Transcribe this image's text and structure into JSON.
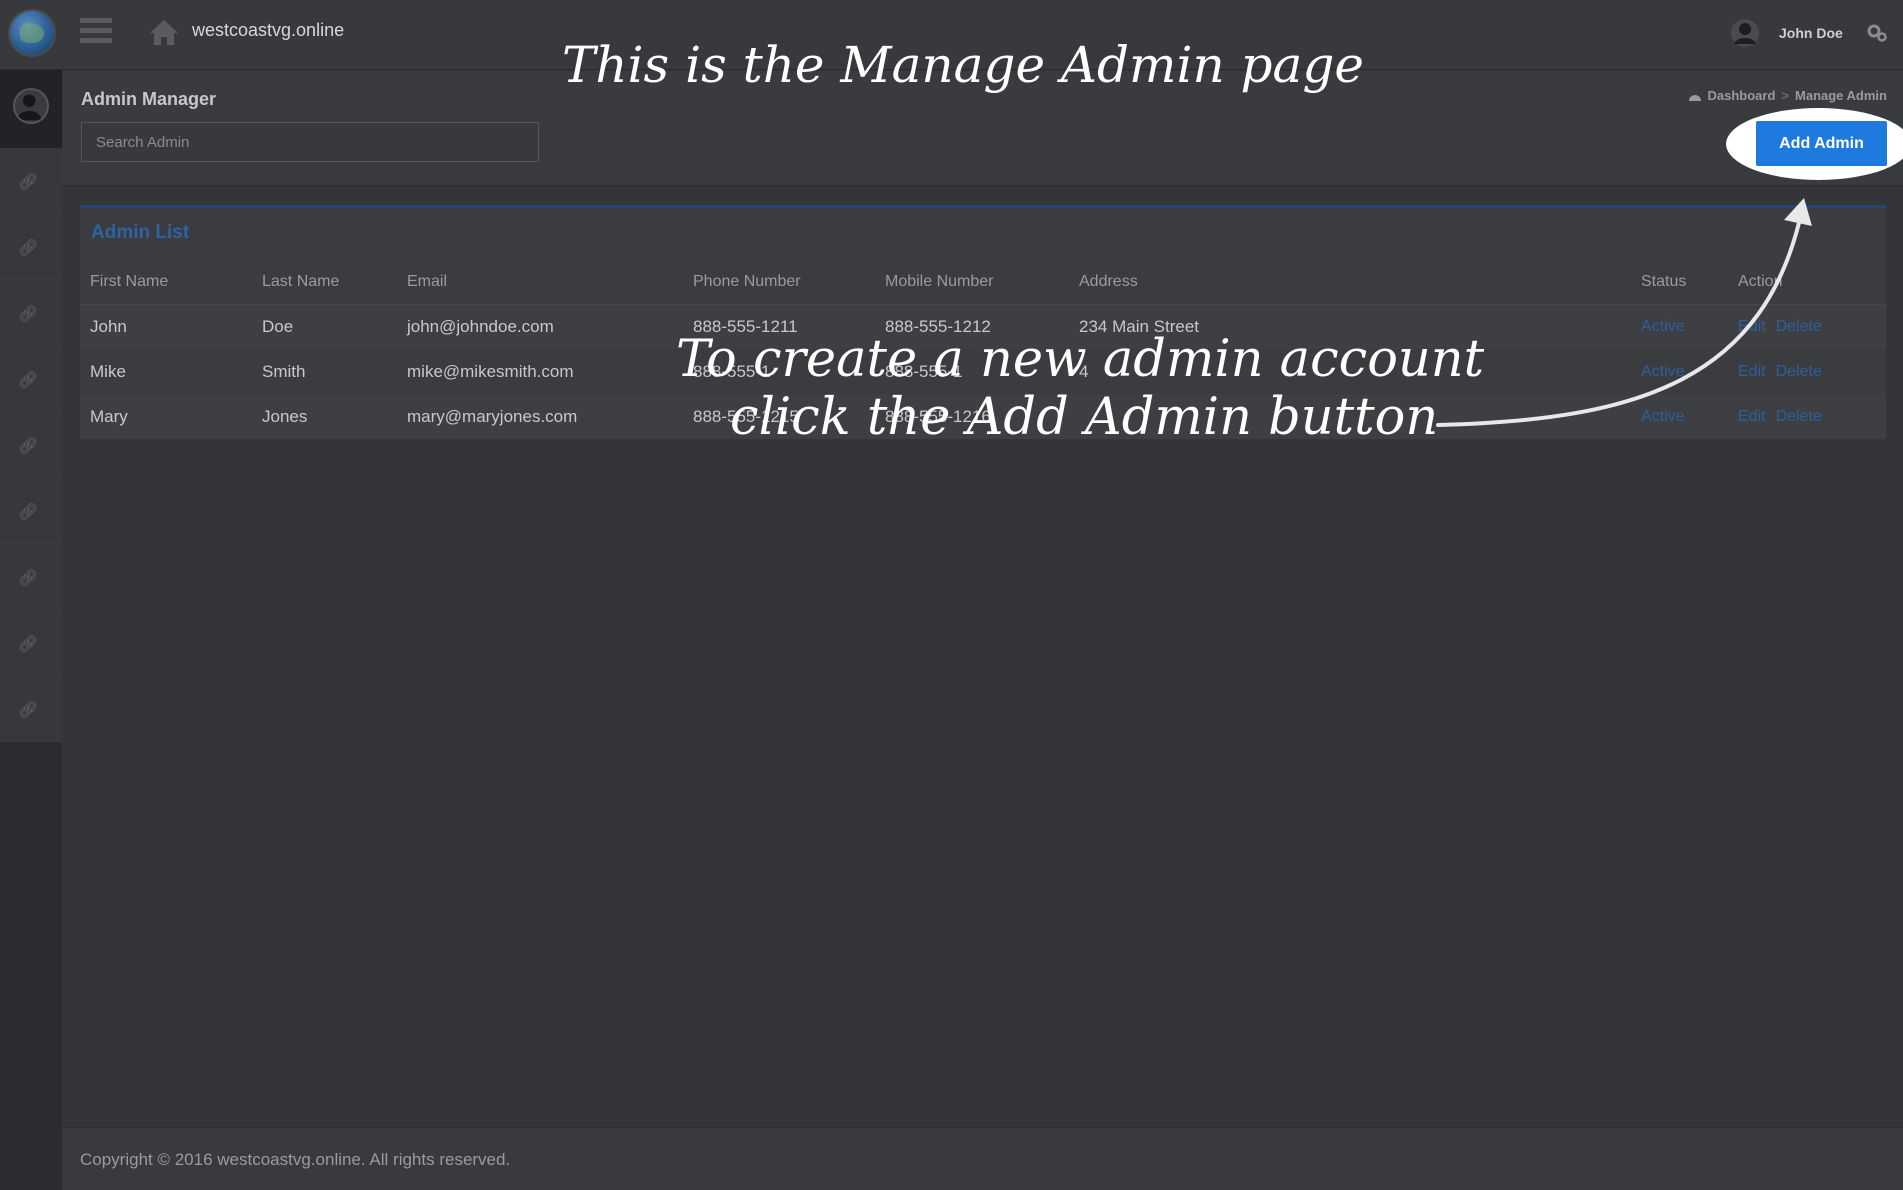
{
  "header": {
    "site_title": "westcoastvg.online",
    "user_name": "John Doe"
  },
  "page": {
    "heading": "Admin Manager",
    "search_placeholder": "Search Admin",
    "breadcrumb": [
      "Dashboard",
      "Manage Admin"
    ],
    "add_button_label": "Add Admin"
  },
  "panel": {
    "title": "Admin List",
    "columns": [
      "First Name",
      "Last Name",
      "Email",
      "Phone Number",
      "Mobile Number",
      "Address",
      "Status",
      "Action"
    ],
    "rows": [
      {
        "first": "John",
        "last": "Doe",
        "email": "john@johndoe.com",
        "phone": "888-555-1211",
        "mobile": "888-555-1212",
        "address": "234 Main Street",
        "status": "Active",
        "edit": "Edit",
        "delete": "Delete"
      },
      {
        "first": "Mike",
        "last": "Smith",
        "email": "mike@mikesmith.com",
        "phone": "888-555-1",
        "mobile": "888-555-1",
        "address": "4",
        "status": "Active",
        "edit": "Edit",
        "delete": "Delete"
      },
      {
        "first": "Mary",
        "last": "Jones",
        "email": "mary@maryjones.com",
        "phone": "888-555-1215",
        "mobile": "888-555-1216",
        "address": "",
        "status": "Active",
        "edit": "Edit",
        "delete": "Delete"
      }
    ]
  },
  "annotations": {
    "top": "This is the Manage Admin page",
    "line1": "To create a new admin account",
    "line2": "click the Add Admin button"
  },
  "footer": {
    "copyright": "Copyright © 2016 westcoastvg.online. All rights reserved."
  },
  "sidebar": {
    "item_count_icon": "link-icon"
  },
  "colors": {
    "accent": "#1f7ae0",
    "link": "#2d5f9a"
  }
}
